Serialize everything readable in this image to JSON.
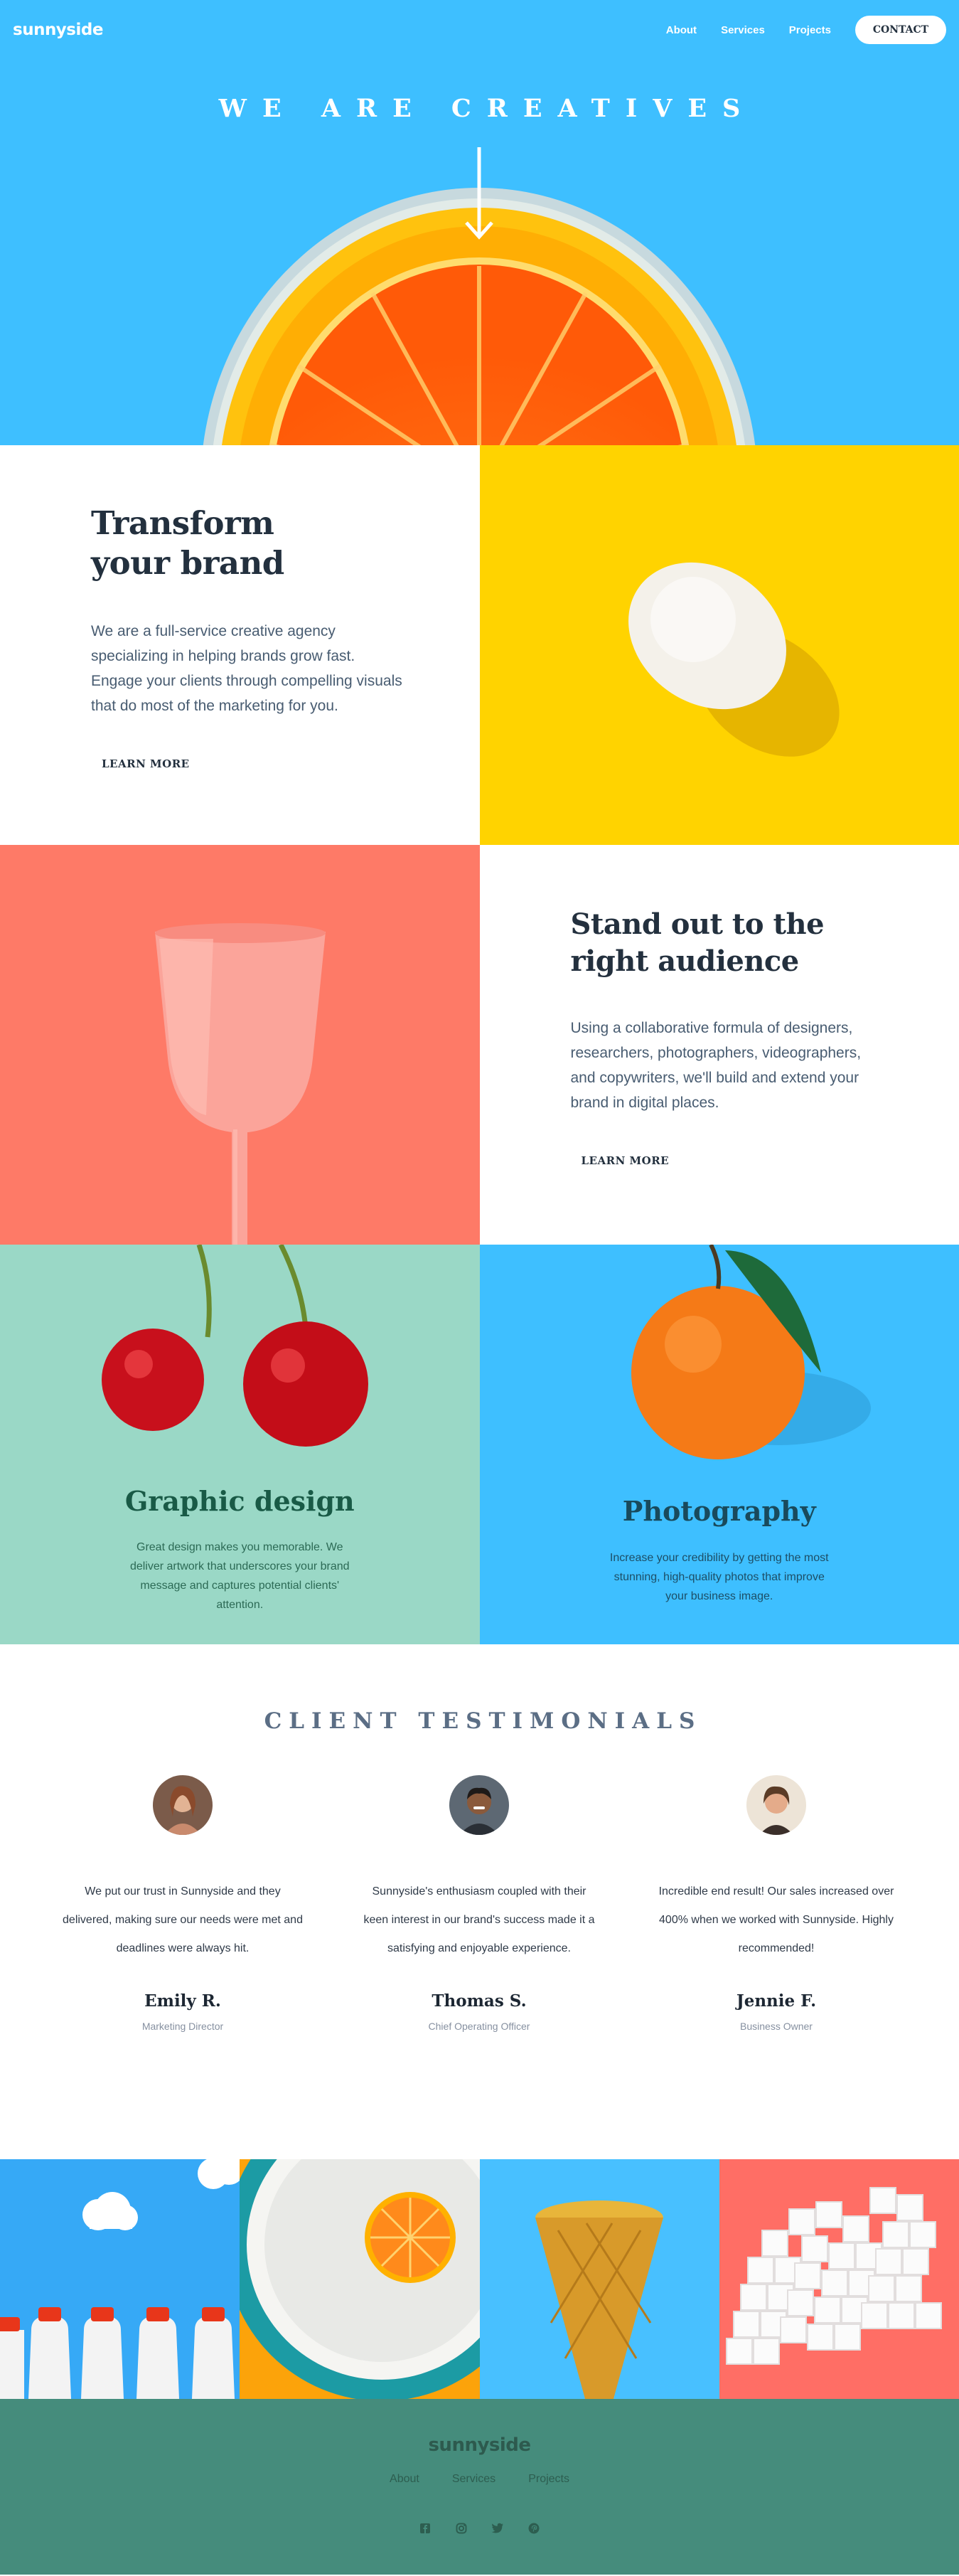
{
  "header": {
    "logo": "sunnyside",
    "nav": [
      "About",
      "Services",
      "Projects"
    ],
    "contact_label": "CONTACT"
  },
  "hero": {
    "title": "WE ARE CREATIVES"
  },
  "features": {
    "transform": {
      "title_line1": "Transform",
      "title_line2": "your brand",
      "body": "We are a full-service creative agency specializing in helping brands grow fast. Engage your clients through compelling visuals that do most of the marketing for you.",
      "cta": "LEARN MORE"
    },
    "standout": {
      "title_line1": "Stand out to the",
      "title_line2": "right audience",
      "body": "Using a collaborative formula of designers, researchers, photographers, videographers, and copywriters, we'll build and extend your brand in digital places.",
      "cta": "LEARN MORE"
    },
    "graphic": {
      "title": "Graphic design",
      "body": "Great design makes you memorable. We deliver artwork that underscores your brand message and captures potential clients' attention."
    },
    "photo": {
      "title": "Photography",
      "body": "Increase your credibility by getting the most stunning, high-quality photos that improve your business image."
    }
  },
  "testimonials": {
    "heading": "CLIENT TESTIMONIALS",
    "items": [
      {
        "text": "We put our trust in Sunnyside and they delivered, making sure our needs were met and deadlines were always hit.",
        "name": "Emily R.",
        "role": "Marketing Director"
      },
      {
        "text": "Sunnyside's enthusiasm coupled with their keen interest in our brand's success made it a satisfying and enjoyable experience.",
        "name": "Thomas S.",
        "role": "Chief Operating Officer"
      },
      {
        "text": "Incredible end result! Our sales increased over 400% when we worked with Sunnyside. Highly recommended!",
        "name": "Jennie F.",
        "role": "Business Owner"
      }
    ]
  },
  "footer": {
    "logo": "sunnyside",
    "nav": [
      "About",
      "Services",
      "Projects"
    ],
    "socials": [
      "facebook-icon",
      "instagram-icon",
      "twitter-icon",
      "pinterest-icon"
    ]
  },
  "colors": {
    "hero_blue": "#3ebfff",
    "egg_yellow": "#ffd300",
    "glass_red": "#fe7a67",
    "cherry_mint": "#9ad8c6",
    "footer_green": "#458c7c"
  }
}
